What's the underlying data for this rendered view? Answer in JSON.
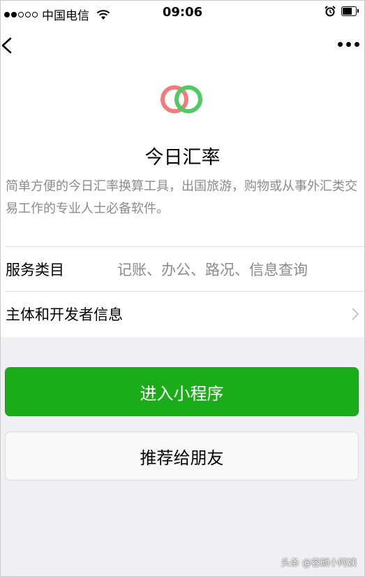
{
  "status_bar": {
    "carrier": "中国电信",
    "time": "09:06",
    "signal": {
      "filled": 2,
      "total": 5
    },
    "battery_level": 0.75
  },
  "nav": {
    "back_icon": "chevron-left-icon",
    "more_icon": "more-dots-icon"
  },
  "app": {
    "name": "今日汇率",
    "description": "简单方便的今日汇率换算工具，出国旅游，购物或从事外汇类交易工作的专业人士必备软件。",
    "logo_colors": {
      "left": "#f07c7c",
      "right": "#4fcb62"
    }
  },
  "info_rows": {
    "service_category": {
      "label": "服务类目",
      "value": "记账、办公、路况、信息查询"
    },
    "developer_info": {
      "label": "主体和开发者信息"
    }
  },
  "buttons": {
    "enter": "进入小程序",
    "share": "推荐给朋友"
  },
  "watermark": "头条 @容颜小阿姨",
  "colors": {
    "primary_green": "#1aad19",
    "page_bg": "#efeff4"
  }
}
